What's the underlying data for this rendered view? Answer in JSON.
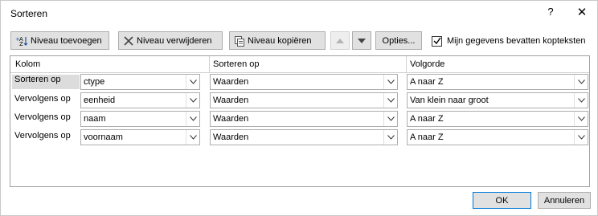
{
  "window": {
    "title": "Sorteren",
    "help_label": "?",
    "close_label": "✕"
  },
  "toolbar": {
    "add_level": "Niveau toevoegen",
    "delete_level": "Niveau verwijderen",
    "copy_level": "Niveau kopiëren",
    "options": "Opties...",
    "headers_checkbox_label": "Mijn gegevens bevatten kopteksten",
    "headers_checked": true
  },
  "columns": {
    "kolom": "Kolom",
    "sort_on": "Sorteren op",
    "order": "Volgorde"
  },
  "rows": [
    {
      "label": "Sorteren op",
      "column": "ctype",
      "sort_on": "Waarden",
      "order": "A naar Z"
    },
    {
      "label": "Vervolgens op",
      "column": "eenheid",
      "sort_on": "Waarden",
      "order": "Van klein naar groot"
    },
    {
      "label": "Vervolgens op",
      "column": "naam",
      "sort_on": "Waarden",
      "order": "A naar Z"
    },
    {
      "label": "Vervolgens op",
      "column": "voornaam",
      "sort_on": "Waarden",
      "order": "A naar Z"
    }
  ],
  "footer": {
    "ok": "OK",
    "cancel": "Annuleren"
  }
}
